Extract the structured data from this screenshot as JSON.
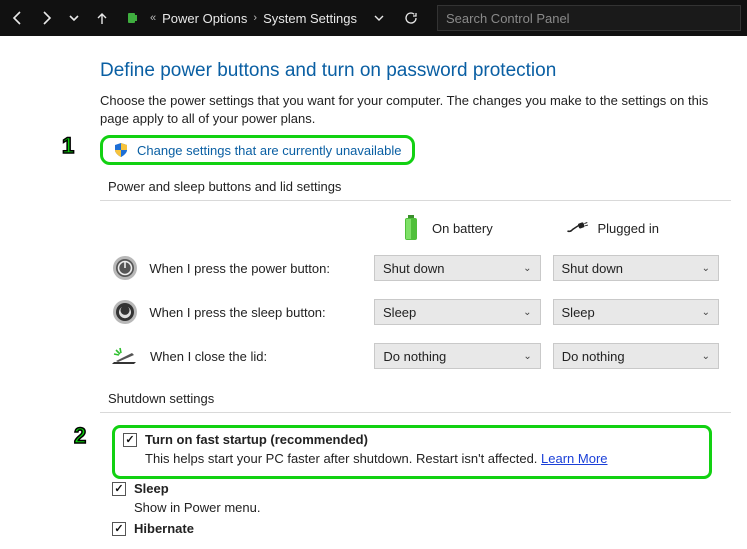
{
  "titlebar": {
    "breadcrumb_prefix": "«",
    "crumb1": "Power Options",
    "crumb2": "System Settings",
    "search_placeholder": "Search Control Panel"
  },
  "page": {
    "title": "Define power buttons and turn on password protection",
    "intro": "Choose the power settings that you want for your computer. The changes you make to the settings on this page apply to all of your power plans.",
    "change_link": "Change settings that are currently unavailable"
  },
  "section": {
    "buttons_title": "Power and sleep buttons and lid settings",
    "shutdown_title": "Shutdown settings"
  },
  "cols": {
    "battery": "On battery",
    "plugged": "Plugged in"
  },
  "rows": {
    "power": {
      "label": "When I press the power button:",
      "battery": "Shut down",
      "plugged": "Shut down"
    },
    "sleep": {
      "label": "When I press the sleep button:",
      "battery": "Sleep",
      "plugged": "Sleep"
    },
    "lid": {
      "label": "When I close the lid:",
      "battery": "Do nothing",
      "plugged": "Do nothing"
    }
  },
  "shutdown": {
    "fast_label": "Turn on fast startup (recommended)",
    "fast_desc": "This helps start your PC faster after shutdown. Restart isn't affected. ",
    "learn_more": "Learn More",
    "sleep_label": "Sleep",
    "sleep_desc": "Show in Power menu.",
    "hibernate_label": "Hibernate"
  },
  "annotations": {
    "one": "1",
    "two": "2"
  }
}
